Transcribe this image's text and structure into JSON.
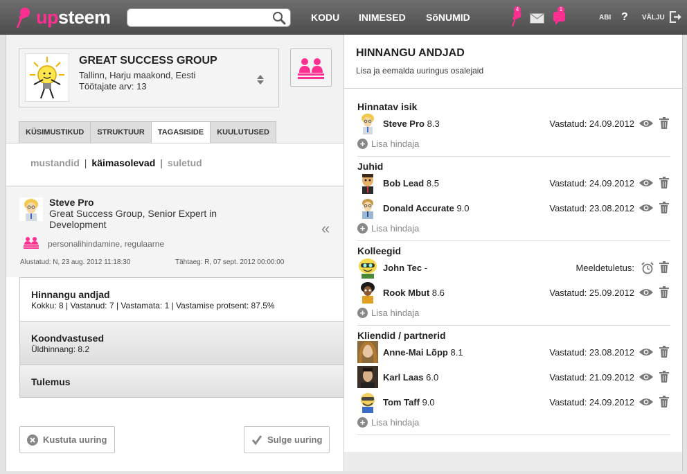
{
  "topbar": {
    "logo_part1": "up",
    "logo_part2": "steem",
    "search_placeholder": "",
    "nav": [
      "KODU",
      "INIMESED",
      "SõNUMID"
    ],
    "badges": {
      "pins": "4",
      "chat": "1"
    },
    "help_label": "ABI",
    "logout_label": "VÄLJU"
  },
  "org": {
    "name": "GREAT SUCCESS GROUP",
    "location": "Tallinn, Harju maakond, Eesti",
    "employees": "Töötajate arv: 13"
  },
  "tabs": [
    "KÜSIMUSTIKUD",
    "STRUKTUUR",
    "TAGASISIDE",
    "KUULUTUSED"
  ],
  "active_tab": "TAGASISIDE",
  "filters": {
    "draft": "mustandid",
    "sep": "|",
    "ongoing": "käimasolevad",
    "closed": "suletud"
  },
  "person": {
    "name": "Steve Pro",
    "title": "Great Success Group, Senior Expert in Development",
    "type": "personalihindamine, regulaarne",
    "started": "Alustatud: N, 23 aug. 2012 11:18:30",
    "deadline": "Tähtaeg: R, 07 sept. 2012 00:00:00"
  },
  "blocks": {
    "raters_title": "Hinnangu andjad",
    "raters_sub": "Kokku: 8 | Vastanud: 7 | Vastamata: 1 | Vastamise protsent: 87.5%",
    "summary_title": "Koondvastused",
    "summary_sub": "Üldhinnang: 8.2",
    "result_title": "Tulemus"
  },
  "buttons": {
    "delete": "Kustuta uuring",
    "close": "Sulge uuring"
  },
  "right": {
    "title": "HINNANGU ANDJAD",
    "subtitle": "Lisa ja eemalda uuringus osalejaid",
    "add_label": "Lisa hindaja",
    "groups": [
      {
        "title": "Hinnatav isik",
        "rows": [
          {
            "name": "Steve Pro",
            "score": "8.3",
            "status": "Vastatud: 24.09.2012"
          }
        ]
      },
      {
        "title": "Juhid",
        "rows": [
          {
            "name": "Bob Lead",
            "score": "8.5",
            "status": "Vastatud: 24.09.2012"
          },
          {
            "name": "Donald Accurate",
            "score": "9.0",
            "status": "Vastatud: 23.08.2012"
          }
        ]
      },
      {
        "title": "Kolleegid",
        "rows": [
          {
            "name": "John Tec",
            "score": "-",
            "status": "Meeldetuletus:"
          },
          {
            "name": "Rook Mbut",
            "score": "8.6",
            "status": "Vastatud: 25.09.2012"
          }
        ]
      },
      {
        "title": "Kliendid / partnerid",
        "rows": [
          {
            "name": "Anne-Mai Lõpp",
            "score": "8.1",
            "status": "Vastatud: 23.08.2012"
          },
          {
            "name": "Karl Laas",
            "score": "6.0",
            "status": "Vastatud: 21.09.2012"
          },
          {
            "name": "Tom Taff",
            "score": "9.0",
            "status": "Vastatud: 24.09.2012"
          }
        ]
      }
    ]
  },
  "colors": {
    "brand": "#ff2f92",
    "topbar": "#5a5a5a"
  }
}
